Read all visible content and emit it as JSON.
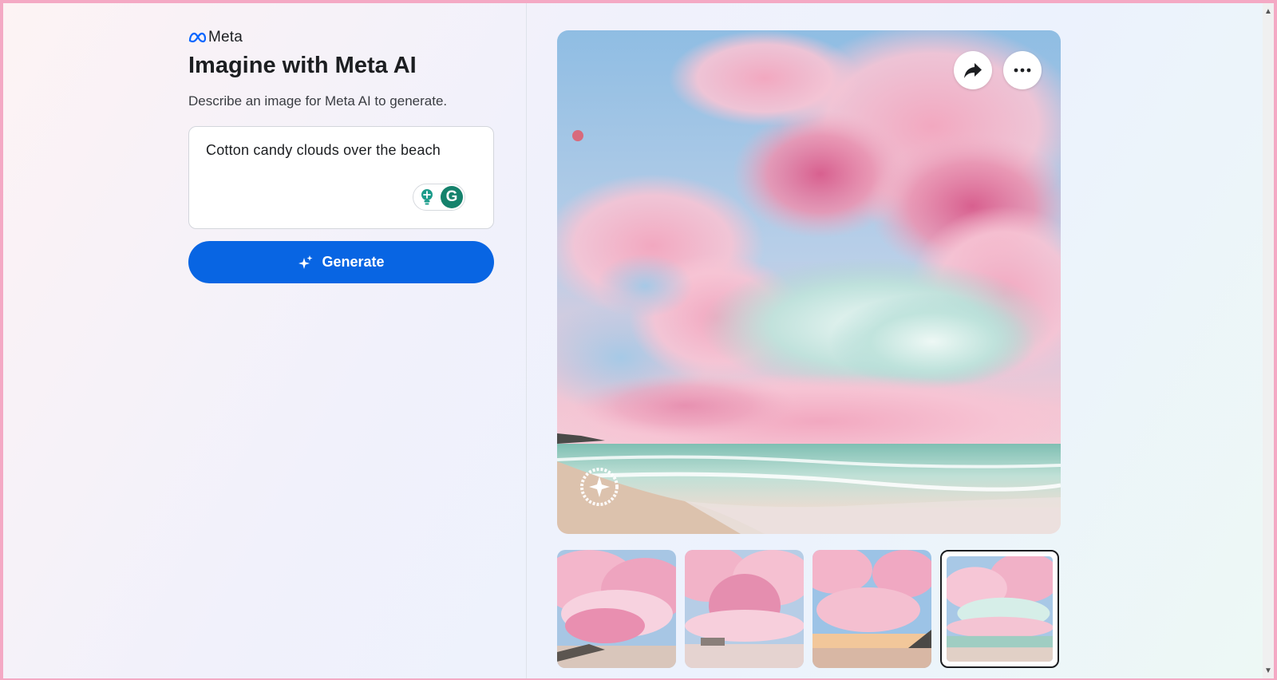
{
  "brand": {
    "name": "Meta",
    "logo_icon": "meta-infinity-logo-icon"
  },
  "header": {
    "title": "Imagine with Meta AI",
    "subtitle": "Describe an image for Meta AI to generate."
  },
  "prompt": {
    "value": "Cotton candy clouds over the beach",
    "grammarly_letter": "G"
  },
  "generate_button": {
    "label": "Generate",
    "icon": "sparkle-icon"
  },
  "image_actions": {
    "share_icon": "share-arrow-icon",
    "more_icon": "more-dots-icon"
  },
  "watermark": {
    "icon": "imagined-with-ai-watermark-icon"
  },
  "thumbnails": [
    {
      "name": "variant-1",
      "selected": false
    },
    {
      "name": "variant-2",
      "selected": false
    },
    {
      "name": "variant-3",
      "selected": false
    },
    {
      "name": "variant-4",
      "selected": true
    }
  ],
  "colors": {
    "accent": "#0865e3",
    "border_pink": "#f4a9c4",
    "title_text": "#1c1e21"
  }
}
